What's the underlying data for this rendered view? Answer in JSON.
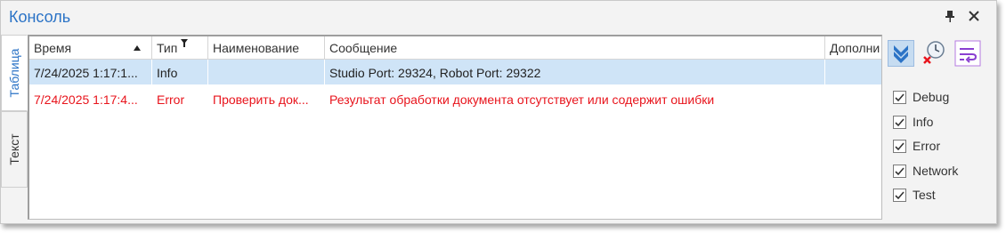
{
  "window": {
    "title": "Консоль"
  },
  "tabs": [
    {
      "label": "Таблица",
      "active": true
    },
    {
      "label": "Текст",
      "active": false
    }
  ],
  "grid": {
    "columns": [
      "Время",
      "Тип",
      "Наименование",
      "Сообщение",
      "Дополни"
    ],
    "rows": [
      {
        "time": "7/24/2025 1:17:1...",
        "type": "Info",
        "name": "",
        "message": "Studio Port: 29324, Robot Port: 29322",
        "additional": "",
        "selected": true
      },
      {
        "time": "7/24/2025 1:17:4...",
        "type": "Error",
        "name": "Проверить док...",
        "message": "Результат обработки документа отсутствует или содержит ошибки",
        "additional": "",
        "selected": false
      }
    ]
  },
  "filters": [
    {
      "label": "Debug",
      "checked": true
    },
    {
      "label": "Info",
      "checked": true
    },
    {
      "label": "Error",
      "checked": true
    },
    {
      "label": "Network",
      "checked": true
    },
    {
      "label": "Test",
      "checked": true
    }
  ],
  "colors": {
    "accent": "#2b73c6",
    "error": "#e8141c",
    "selected_row": "#cfe4f7"
  },
  "icons": [
    "pin-icon",
    "close-icon",
    "sort-ascending-icon",
    "filter-icon",
    "scroll-down-icon",
    "clear-log-icon",
    "word-wrap-icon"
  ]
}
